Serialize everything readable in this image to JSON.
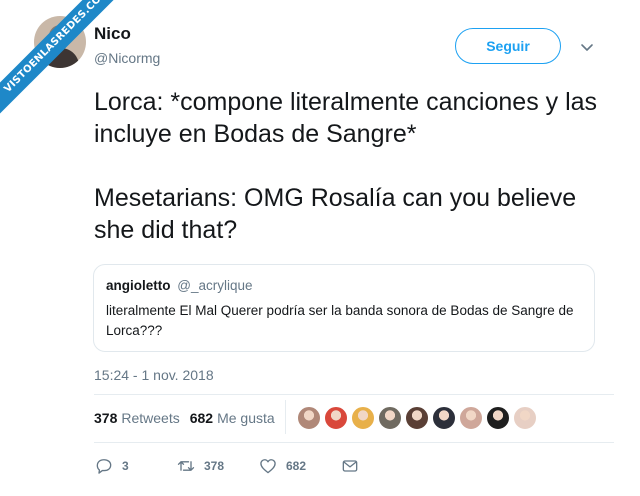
{
  "watermark": {
    "text": "VISTOENLASREDES.COM"
  },
  "author": {
    "name": "Nico",
    "handle": "@Nicormg",
    "avatar_colors": [
      "#3d3533",
      "#8a7a70",
      "#c9b8a8"
    ]
  },
  "header": {
    "follow_label": "Seguir",
    "menu_icon": "chevron-down-icon"
  },
  "tweet": {
    "paragraphs": [
      "Lorca: *compone literalmente canciones y las incluye en Bodas de Sangre*",
      "Mesetarians: OMG Rosalía can you believe she did that?"
    ]
  },
  "quoted_tweet": {
    "name": "angioletto",
    "handle": "@_acrylique",
    "text": "literalmente El Mal Querer podría ser la banda sonora de Bodas de Sangre de Lorca???"
  },
  "timestamp": "15:24 - 1 nov. 2018",
  "stats": {
    "retweets_count": "378",
    "retweets_label": "Retweets",
    "likes_count": "682",
    "likes_label": "Me gusta"
  },
  "likers": [
    {
      "color": "#b08878"
    },
    {
      "color": "#d9483b"
    },
    {
      "color": "#e8b04a"
    },
    {
      "color": "#6f6a60"
    },
    {
      "color": "#5a3f35"
    },
    {
      "color": "#2c2f3a"
    },
    {
      "color": "#cfa79a"
    },
    {
      "color": "#1e1e1e"
    },
    {
      "color": "#e7cfc4"
    }
  ],
  "actions": {
    "replies": "3",
    "retweets": "378",
    "likes": "682"
  },
  "colors": {
    "accent": "#1da1f2",
    "text": "#14171a",
    "secondary": "#657786",
    "border": "#e1e8ed"
  }
}
